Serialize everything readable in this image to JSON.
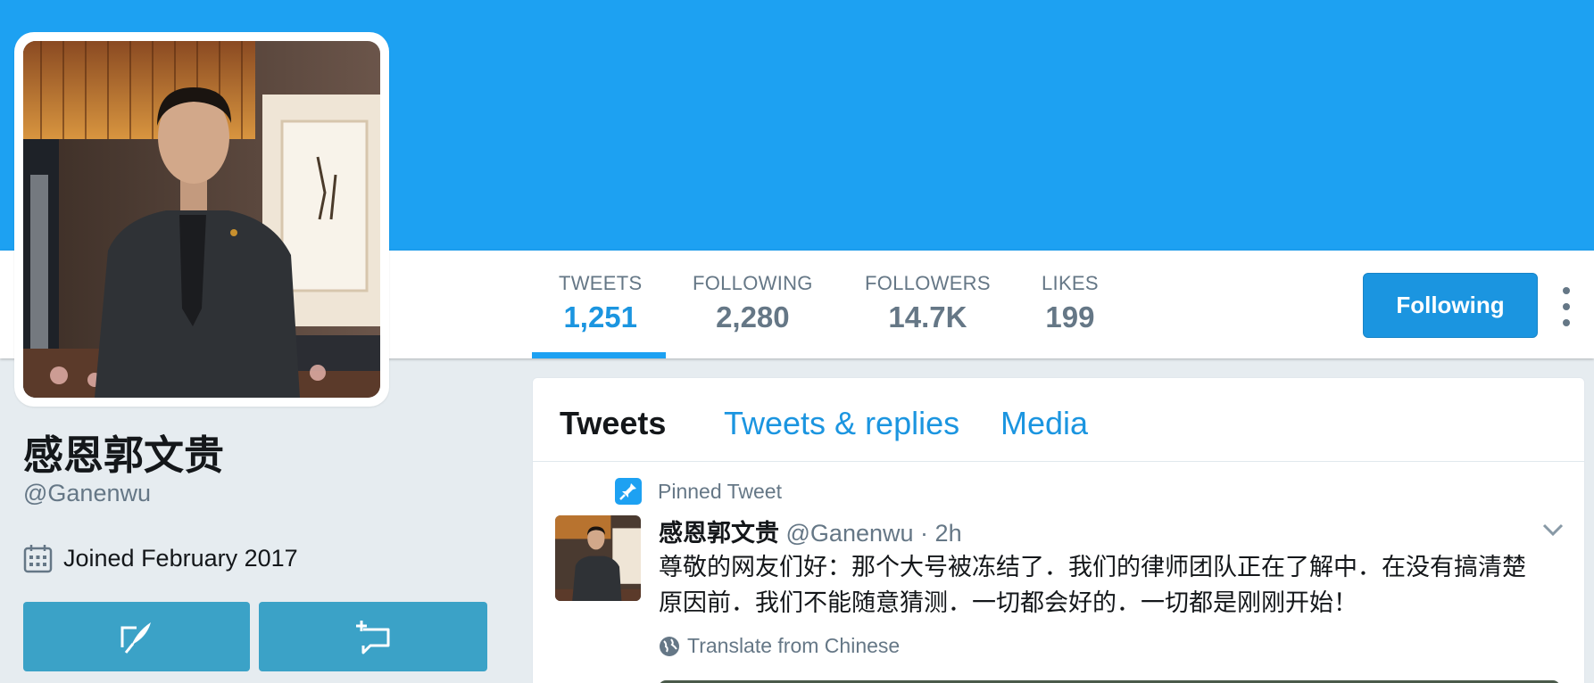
{
  "colors": {
    "brand": "#1da1f2",
    "link": "#1b95e0",
    "muted": "#657786",
    "text": "#14171a",
    "background": "#e6ecf0",
    "side_button": "#3ba2c7"
  },
  "profile": {
    "name": "感恩郭文贵",
    "handle": "@Ganenwu",
    "joined": "Joined February 2017",
    "avatar_icon": "profile-photo",
    "tweet_to_icon": "quill-icon",
    "message_icon": "direct-message-icon"
  },
  "stats": [
    {
      "label": "TWEETS",
      "value": "1,251",
      "active": true
    },
    {
      "label": "FOLLOWING",
      "value": "2,280",
      "active": false
    },
    {
      "label": "FOLLOWERS",
      "value": "14.7K",
      "active": false
    },
    {
      "label": "LIKES",
      "value": "199",
      "active": false
    }
  ],
  "actions": {
    "follow_label": "Following",
    "more_icon": "vertical-ellipsis-icon"
  },
  "timeline": {
    "tabs": [
      "Tweets",
      "Tweets & replies",
      "Media"
    ],
    "active_tab": "Tweets",
    "pinned_label": "Pinned Tweet",
    "tweet": {
      "name": "感恩郭文贵",
      "handle": "@Ganenwu",
      "separator": "·",
      "time": "2h",
      "text_line1": "尊敬的网友们好：那个大号被冻结了．我们的律师团队正在了解中．在没有搞清楚",
      "text_line2": "原因前．我们不能随意猜测．一切都会好的．一切都是刚刚开始！",
      "translate_label": "Translate from Chinese"
    }
  }
}
